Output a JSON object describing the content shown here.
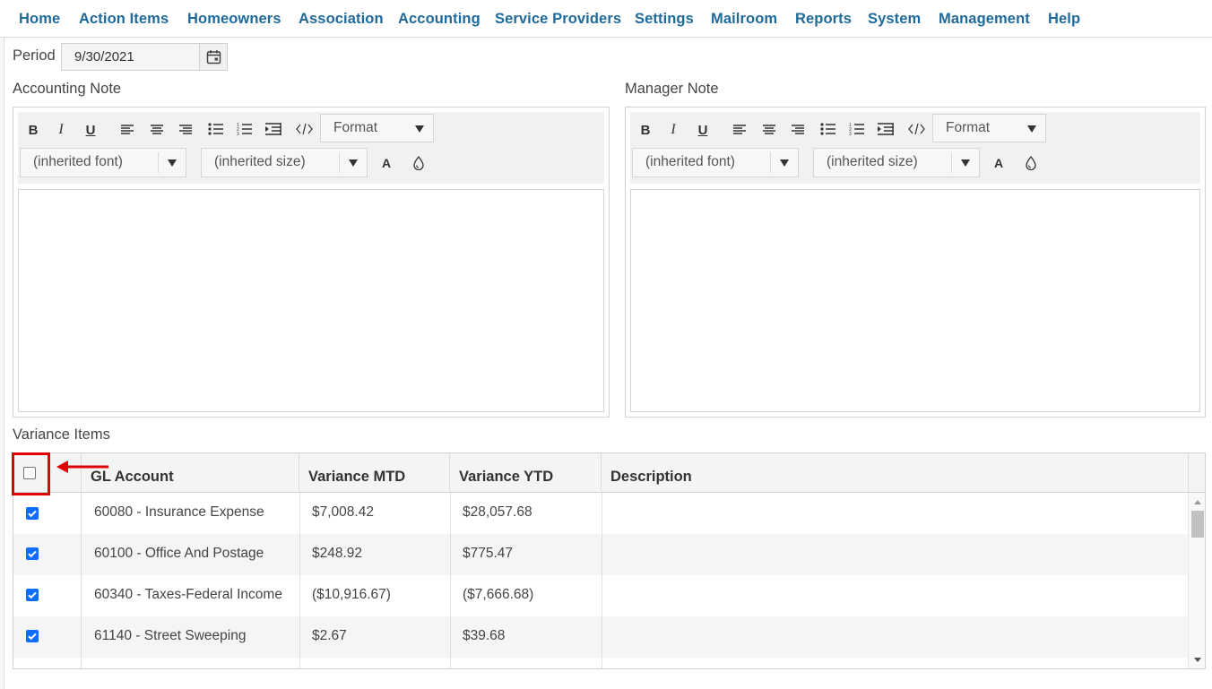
{
  "nav": {
    "items": [
      "Home",
      "Action Items",
      "Homeowners",
      "Association",
      "Accounting",
      "Service Providers",
      "Settings",
      "Mailroom",
      "Reports",
      "System",
      "Management",
      "Help"
    ]
  },
  "period": {
    "label": "Period",
    "value": "9/30/2021"
  },
  "accounting_note": {
    "label": "Accounting Note",
    "format_label": "Format",
    "font_label": "(inherited font)",
    "size_label": "(inherited size)"
  },
  "manager_note": {
    "label": "Manager Note",
    "format_label": "Format",
    "font_label": "(inherited font)",
    "size_label": "(inherited size)"
  },
  "variance": {
    "label": "Variance Items",
    "columns": [
      "GL Account",
      "Variance MTD",
      "Variance YTD",
      "Description"
    ],
    "rows": [
      {
        "checked": true,
        "gl_account": "60080 - Insurance Expense",
        "mtd": "$7,008.42",
        "ytd": "$28,057.68",
        "description": ""
      },
      {
        "checked": true,
        "gl_account": "60100 - Office And Postage",
        "mtd": "$248.92",
        "ytd": "$775.47",
        "description": ""
      },
      {
        "checked": true,
        "gl_account": "60340 - Taxes-Federal Income",
        "mtd": "($10,916.67)",
        "ytd": "($7,666.68)",
        "description": ""
      },
      {
        "checked": true,
        "gl_account": "61140 - Street Sweeping",
        "mtd": "$2.67",
        "ytd": "$39.68",
        "description": ""
      }
    ]
  },
  "colors": {
    "nav_link": "#1f6a9a",
    "checkbox_on": "#0d6efd",
    "highlight": "#e00000"
  }
}
